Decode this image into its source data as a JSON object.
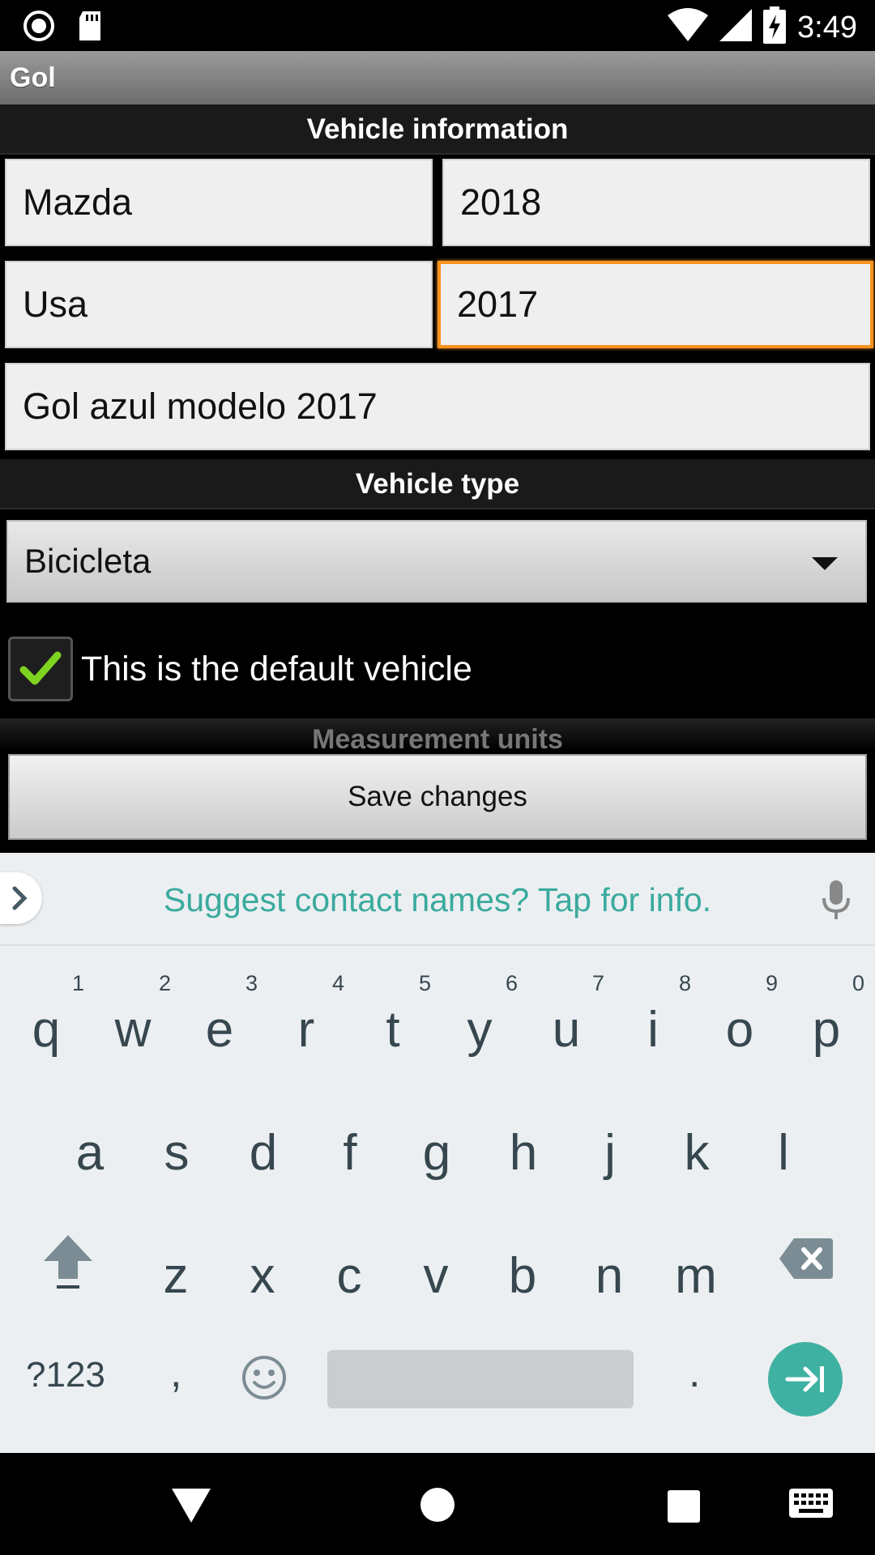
{
  "status_bar": {
    "time": "3:49",
    "icons": [
      "record-icon",
      "sd-card-icon",
      "wifi-icon",
      "signal-icon",
      "battery-charging-icon"
    ]
  },
  "app": {
    "title": "Gol"
  },
  "vehicle_information": {
    "header": "Vehicle information",
    "brand_value": "Mazda",
    "year_value": "2018",
    "country_value": "Usa",
    "model_year_value": "2017",
    "description_value": "Gol azul modelo 2017"
  },
  "vehicle_type": {
    "header": "Vehicle type",
    "selected": "Bicicleta"
  },
  "default_vehicle": {
    "label": "This is the default vehicle",
    "checked": true
  },
  "measurement_units": {
    "header": "Measurement units"
  },
  "save_button": {
    "label": "Save changes"
  },
  "keyboard": {
    "suggestion": "Suggest contact names? Tap for info.",
    "row1": [
      {
        "key": "q",
        "hint": "1"
      },
      {
        "key": "w",
        "hint": "2"
      },
      {
        "key": "e",
        "hint": "3"
      },
      {
        "key": "r",
        "hint": "4"
      },
      {
        "key": "t",
        "hint": "5"
      },
      {
        "key": "y",
        "hint": "6"
      },
      {
        "key": "u",
        "hint": "7"
      },
      {
        "key": "i",
        "hint": "8"
      },
      {
        "key": "o",
        "hint": "9"
      },
      {
        "key": "p",
        "hint": "0"
      }
    ],
    "row2": [
      "a",
      "s",
      "d",
      "f",
      "g",
      "h",
      "j",
      "k",
      "l"
    ],
    "row3": [
      "z",
      "x",
      "c",
      "v",
      "b",
      "n",
      "m"
    ],
    "symbols_label": "?123",
    "comma": ",",
    "period": ".",
    "accent_color": "#3fb1a3"
  },
  "nav_bar": {
    "icons": [
      "back-icon",
      "home-icon",
      "recents-icon",
      "keyboard-switch-icon"
    ]
  }
}
